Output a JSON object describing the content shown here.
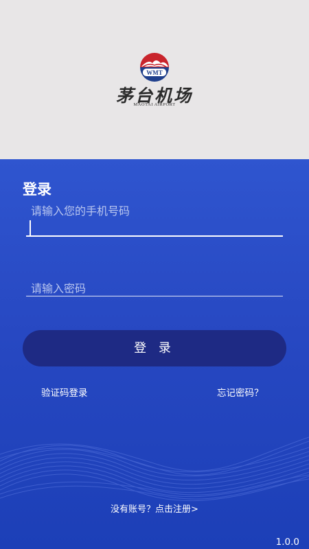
{
  "header": {
    "logo_badge_text": "WMT",
    "logo_name_cn": "茅台机场",
    "logo_name_en": "MAOTAI AIRPORT"
  },
  "login": {
    "title": "登录",
    "phone_placeholder": "请输入您的手机号码",
    "password_placeholder": "请输入密码",
    "login_button": "登 录",
    "sms_login_link": "验证码登录",
    "forgot_password_link": "忘记密码？",
    "register_link": "没有账号？点击注册>"
  },
  "app": {
    "version": "1.0.0"
  }
}
